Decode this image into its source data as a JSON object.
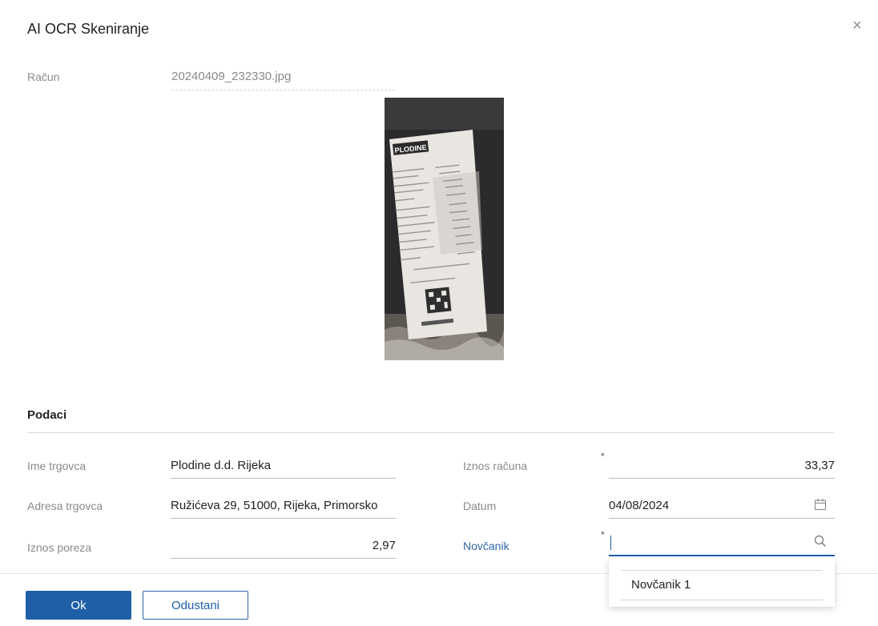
{
  "dialog": {
    "title": "AI OCR Skeniranje",
    "close_label": "×"
  },
  "receipt": {
    "label": "Račun",
    "file_name": "20240409_232330.jpg",
    "image_store_name": "PLODINE"
  },
  "section": {
    "title": "Podaci"
  },
  "fields": {
    "merchant_name": {
      "label": "Ime trgovca",
      "value": "Plodine d.d. Rijeka"
    },
    "merchant_address": {
      "label": "Adresa trgovca",
      "value": "Ružićeva 29, 51000, Rijeka, Primorsko"
    },
    "tax_amount": {
      "label": "Iznos poreza",
      "value": "2,97"
    },
    "bill_amount": {
      "label": "Iznos računa",
      "value": "33,37",
      "required": "*"
    },
    "date": {
      "label": "Datum",
      "value": "04/08/2024"
    },
    "wallet": {
      "label": "Novčanik",
      "value": "",
      "required": "*"
    }
  },
  "wallet_dropdown": {
    "options": [
      "Novčanik 1"
    ]
  },
  "buttons": {
    "ok": "Ok",
    "cancel": "Odustani"
  },
  "colors": {
    "primary": "#1f5fa8",
    "label": "#8a8a8a"
  },
  "icons": {
    "close": "close-icon",
    "calendar": "calendar-icon",
    "search": "search-icon"
  }
}
